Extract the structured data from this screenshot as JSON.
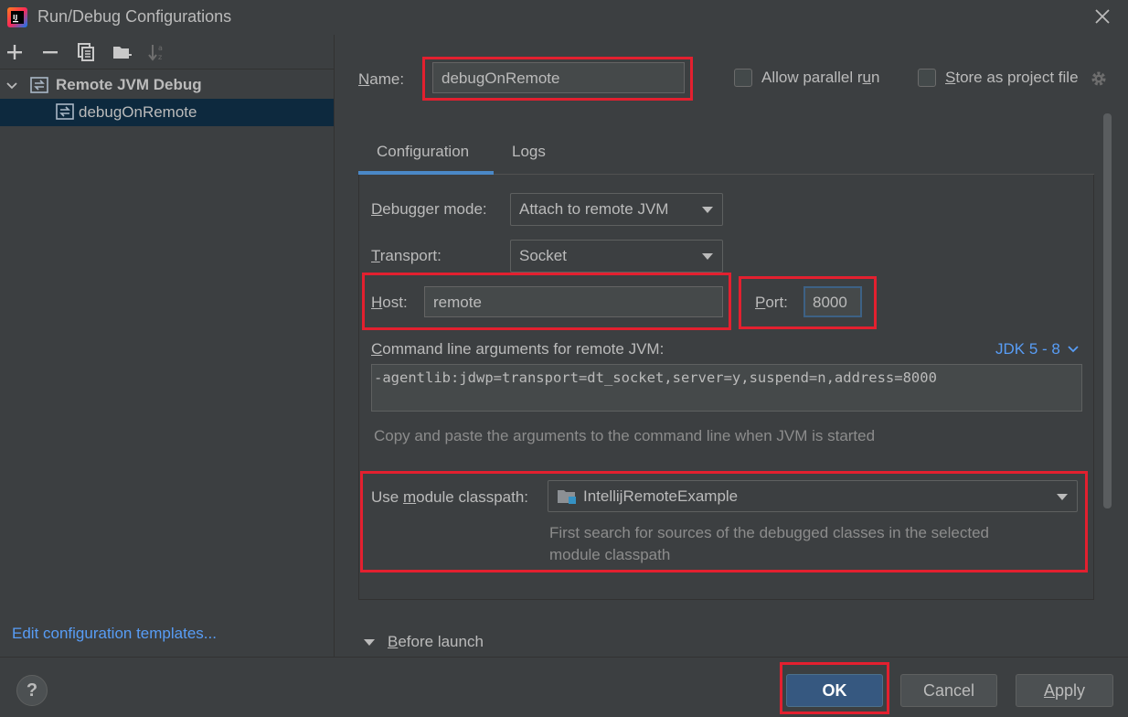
{
  "window": {
    "title": "Run/Debug Configurations",
    "app_icon": "intellij-idea-icon",
    "close_icon": "close-icon"
  },
  "toolbar": {
    "icons": [
      "add-icon",
      "remove-icon",
      "copy-icon",
      "new-folder-icon",
      "sort-alpha-icon"
    ]
  },
  "tree": {
    "root": {
      "label": "Remote JVM Debug",
      "icon": "remote-debug-icon"
    },
    "child": {
      "label": "debugOnRemote",
      "icon": "remote-debug-icon"
    }
  },
  "edit_templates_link": "Edit configuration templates...",
  "form": {
    "name_label_first": "N",
    "name_label_rest": "ame:",
    "name_value": "debugOnRemote",
    "allow_parallel_first": "Allow parallel r",
    "allow_parallel_u": "u",
    "allow_parallel_rest": "n",
    "store_project_first": "S",
    "store_project_rest": "tore as project file"
  },
  "tabs": [
    {
      "label": "Configuration",
      "active": true
    },
    {
      "label": "Logs",
      "active": false
    }
  ],
  "config": {
    "debugger_mode_first": "D",
    "debugger_mode_rest": "ebugger mode:",
    "debugger_mode_value": "Attach to remote JVM",
    "transport_first": "T",
    "transport_rest": "ransport:",
    "transport_value": "Socket",
    "host_first": "H",
    "host_rest": "ost:",
    "host_value": "remote",
    "port_first": "P",
    "port_rest": "ort:",
    "port_value": "8000",
    "cmd_label_first": "C",
    "cmd_label_rest": "ommand line arguments for remote JVM:",
    "jdk_link": "JDK 5 - 8",
    "cmd_value": "-agentlib:jdwp=transport=dt_socket,server=y,suspend=n,address=8000",
    "cmd_hint": "Copy and paste the arguments to the command line when JVM is started",
    "module_label_first": "Use ",
    "module_label_u": "m",
    "module_label_rest": "odule classpath:",
    "module_value": "IntellijRemoteExample",
    "module_hint_1": "First search for sources of the debugged classes in the selected",
    "module_hint_2": "module classpath"
  },
  "before_launch": {
    "first": "B",
    "rest": "efore launch"
  },
  "buttons": {
    "help": "?",
    "ok": "OK",
    "cancel": "Cancel",
    "apply_first": "A",
    "apply_rest": "pply"
  },
  "colors": {
    "background": "#3c3f41",
    "accent": "#4a88c7",
    "link": "#589df6",
    "highlight_box": "#e3202f",
    "ok_button": "#365880"
  }
}
